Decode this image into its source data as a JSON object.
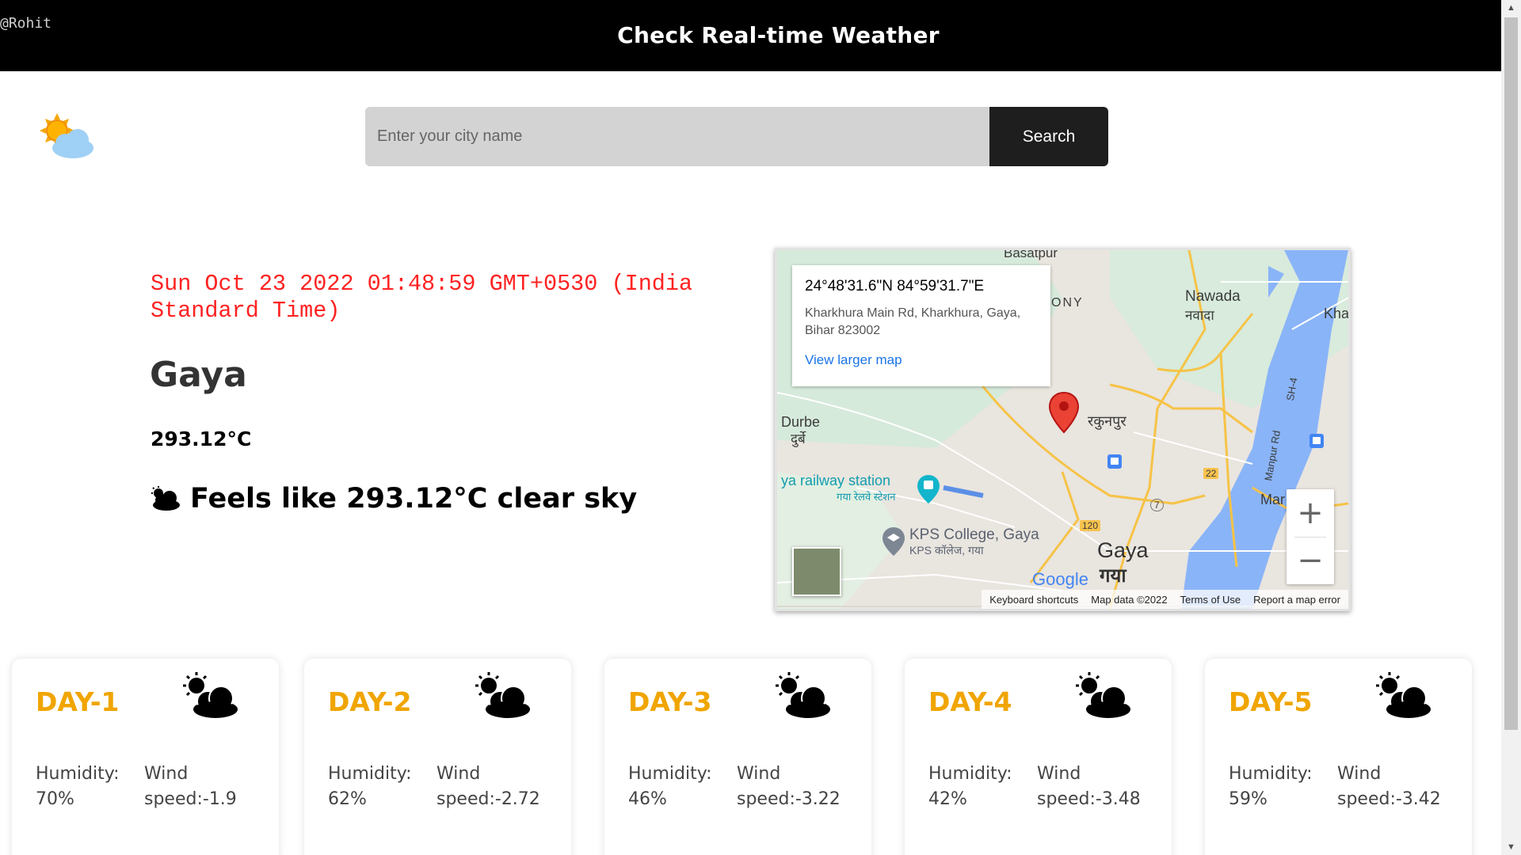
{
  "header": {
    "author": "@Rohit",
    "title": "Check Real-time Weather"
  },
  "search": {
    "placeholder": "Enter your city name",
    "value": "",
    "button_label": "Search"
  },
  "current": {
    "datetime": "Sun Oct 23 2022 01:48:59 GMT+0530 (India Standard Time)",
    "city": "Gaya",
    "temperature": "293.12°C",
    "feels_like_text": "Feels like 293.12°C clear sky"
  },
  "map": {
    "coordinates": "24°48'31.6\"N 84°59'31.7\"E",
    "address": "Kharkhura Main Rd, Kharkhura, Gaya, Bihar 823002",
    "larger_map_link": "View larger map",
    "labels": {
      "basatpur": "Basatpur",
      "ony": "ONY",
      "nawada": "Nawada",
      "nawada_hi": "नवादा",
      "kha": "Kha",
      "durbe": "Durbe",
      "durbe_hi": "दुर्बे",
      "rakunpur": "रकुनपुर",
      "railway": "ya railway station",
      "railway_hi": "गया रेलवे स्टेशन",
      "kps": "KPS College, Gaya",
      "kps_hi": "KPS कॉलेज, गया",
      "gaya": "Gaya",
      "gaya_hi": "गया",
      "road_22": "22",
      "road_120": "120",
      "road_7": "7",
      "sh4": "SH-4",
      "manpur": "Manpur Rd",
      "mar": "Mar"
    },
    "zoom_in": "+",
    "zoom_out": "−",
    "google": "Google",
    "footer": {
      "shortcuts": "Keyboard shortcuts",
      "data": "Map data ©2022",
      "terms": "Terms of Use",
      "report": "Report a map error"
    }
  },
  "forecast": [
    {
      "day": "DAY-1",
      "humidity_label": "Humidity:",
      "humidity": "70%",
      "wind_label": "Wind",
      "wind": "speed:-1.9"
    },
    {
      "day": "DAY-2",
      "humidity_label": "Humidity:",
      "humidity": "62%",
      "wind_label": "Wind",
      "wind": "speed:-2.72"
    },
    {
      "day": "DAY-3",
      "humidity_label": "Humidity:",
      "humidity": "46%",
      "wind_label": "Wind",
      "wind": "speed:-3.22"
    },
    {
      "day": "DAY-4",
      "humidity_label": "Humidity:",
      "humidity": "42%",
      "wind_label": "Wind",
      "wind": "speed:-3.48"
    },
    {
      "day": "DAY-5",
      "humidity_label": "Humidity:",
      "humidity": "59%",
      "wind_label": "Wind",
      "wind": "speed:-3.42"
    }
  ],
  "icons": {
    "logo": "sun-behind-cloud-icon",
    "feels": "cloud-icon",
    "forecast": "sun-behind-cloud-icon"
  },
  "colors": {
    "datetime": "#ff2222",
    "day_title": "#f0a500",
    "header_bg": "#000000",
    "search_button": "#1e1e1e"
  }
}
